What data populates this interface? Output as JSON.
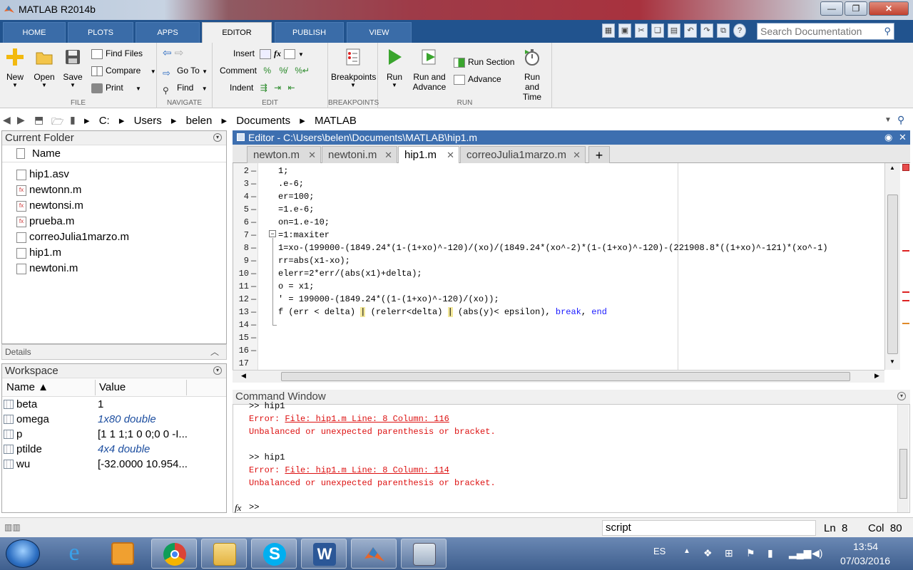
{
  "window": {
    "title": "MATLAB R2014b"
  },
  "ribbon_tabs": [
    {
      "label": "HOME"
    },
    {
      "label": "PLOTS"
    },
    {
      "label": "APPS"
    },
    {
      "label": "EDITOR"
    },
    {
      "label": "PUBLISH"
    },
    {
      "label": "VIEW"
    }
  ],
  "active_tab": "EDITOR",
  "search": {
    "placeholder": "Search Documentation"
  },
  "ribbon": {
    "file": {
      "label": "FILE",
      "new": "New",
      "open": "Open",
      "save": "Save",
      "find_files": "Find Files",
      "compare": "Compare",
      "print": "Print"
    },
    "navigate": {
      "label": "NAVIGATE",
      "go_to": "Go To",
      "find": "Find"
    },
    "edit": {
      "label": "EDIT",
      "insert": "Insert",
      "comment": "Comment",
      "indent": "Indent",
      "fx": "fx"
    },
    "breakpoints": {
      "label": "BREAKPOINTS",
      "breakpoints": "Breakpoints"
    },
    "run": {
      "label": "RUN",
      "run": "Run",
      "run_and_advance_1": "Run and",
      "run_and_advance_2": "Advance",
      "run_section": "Run Section",
      "advance": "Advance",
      "run_and_time_1": "Run and",
      "run_and_time_2": "Time"
    }
  },
  "path": [
    "C:",
    "Users",
    "belen",
    "Documents",
    "MATLAB"
  ],
  "current_folder": {
    "title": "Current Folder",
    "column": "Name",
    "files": [
      "hip1.asv",
      "newtonn.m",
      "newtonsi.m",
      "prueba.m",
      "correoJulia1marzo.m",
      "hip1.m",
      "newtoni.m"
    ]
  },
  "details": {
    "label": "Details"
  },
  "workspace": {
    "title": "Workspace",
    "col_name": "Name ▲",
    "col_value": "Value",
    "vars": [
      {
        "name": "beta",
        "value": "1"
      },
      {
        "name": "omega",
        "value": "1x80 double"
      },
      {
        "name": "p",
        "value": "[1 1 1;1 0 0;0 0 -I..."
      },
      {
        "name": "ptilde",
        "value": "4x4 double"
      },
      {
        "name": "wu",
        "value": "[-32.0000 10.954..."
      }
    ]
  },
  "editor": {
    "title": "Editor - C:\\Users\\belen\\Documents\\MATLAB\\hip1.m",
    "tabs": [
      {
        "label": "newton.m"
      },
      {
        "label": "newtoni.m"
      },
      {
        "label": "hip1.m"
      },
      {
        "label": "correoJulia1marzo.m"
      }
    ],
    "active_tab": "hip1.m",
    "lines": [
      {
        "num": "2",
        "dash": "—",
        "code": "1;"
      },
      {
        "num": "3",
        "dash": "—",
        "code": ".e-6;"
      },
      {
        "num": "4",
        "dash": "—",
        "code": "er=100;"
      },
      {
        "num": "5",
        "dash": "—",
        "code": "=1.e-6;"
      },
      {
        "num": "6",
        "dash": "—",
        "code": "on=1.e-10;"
      },
      {
        "num": "7",
        "dash": "—",
        "code": "=1:maxiter"
      },
      {
        "num": "8",
        "dash": "—",
        "code": "1=xo-(199000-(1849.24*(1-(1+xo)^-120)/(xo)/(1849.24*(xo^-2)*(1-(1+xo)^-120)-(221908.8*((1+xo)^-121)*(xo^-1)"
      },
      {
        "num": "9",
        "dash": "—",
        "code": "rr=abs(x1-xo);"
      },
      {
        "num": "10",
        "dash": "—",
        "code": "elerr=2*err/(abs(x1)+delta);"
      },
      {
        "num": "11",
        "dash": "—",
        "code": "o = x1;"
      },
      {
        "num": "12",
        "dash": "—",
        "code": "' = 199000-(1849.24*((1-(1+xo)^-120)/(xo));"
      },
      {
        "num": "13",
        "dash": "—",
        "code_parts": [
          "f (err < delta) ",
          "|",
          " (relerr<delta) ",
          "|",
          " (abs(y)< epsilon), ",
          "break",
          ", ",
          "end"
        ]
      },
      {
        "num": "14",
        "dash": "—",
        "code": ""
      },
      {
        "num": "15",
        "dash": "—",
        "code": ""
      },
      {
        "num": "16",
        "dash": "—",
        "code": ""
      },
      {
        "num": "17",
        "dash": "",
        "code": ""
      }
    ]
  },
  "command_window": {
    "title": "Command Window",
    "lines": [
      {
        "text": ">> hip1",
        "type": "normal"
      },
      {
        "pre": "Error: ",
        "link": "File: hip1.m Line: 8 Column: 116",
        "type": "error"
      },
      {
        "text": "Unbalanced or unexpected parenthesis or bracket.",
        "type": "error"
      },
      {
        "text": "",
        "type": "normal"
      },
      {
        "text": ">> hip1",
        "type": "normal"
      },
      {
        "pre": "Error: ",
        "link": "File: hip1.m Line: 8 Column: 114",
        "type": "error"
      },
      {
        "text": "Unbalanced or unexpected parenthesis or bracket.",
        "type": "error"
      }
    ],
    "fx": "fx",
    "prompt": ">>"
  },
  "status": {
    "mode": "script",
    "ln_label": "Ln",
    "ln": "8",
    "col_label": "Col",
    "col": "80"
  },
  "taskbar": {
    "apps": [
      "internet-explorer",
      "media-player",
      "chrome",
      "file-explorer",
      "skype",
      "word",
      "matlab",
      "calculator"
    ],
    "lang": "ES",
    "time": "13:54",
    "date": "07/03/2016"
  },
  "colors": {
    "ribbon_blue": "#21538e",
    "error_red": "#d11111",
    "keyword_blue": "#1a1aff",
    "editor_title": "#3d6fb0"
  }
}
